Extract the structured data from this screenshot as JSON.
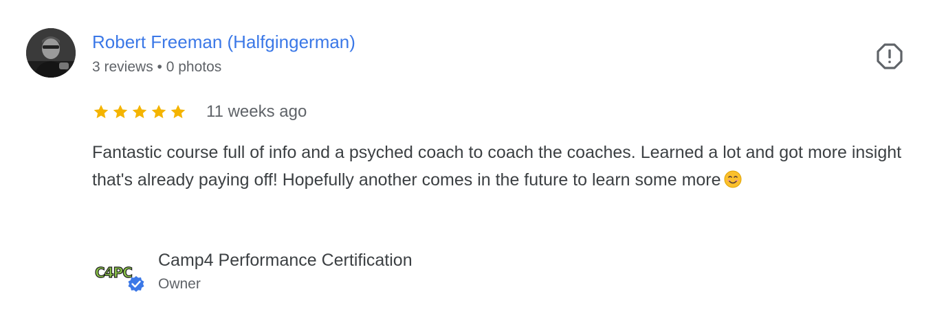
{
  "author": {
    "name": "Robert Freeman (Halfgingerman)",
    "meta": "3 reviews • 0 photos"
  },
  "review": {
    "rating": 5,
    "rating_max": 5,
    "date": "11 weeks ago",
    "text": "Fantastic course full of info and a psyched coach to coach the coaches. Learned a lot and got more insight that's already paying off! Hopefully another comes in the future to learn some more"
  },
  "owner": {
    "logo_text": "C4PC",
    "name": "Camp4 Performance Certification",
    "role": "Owner"
  },
  "icons": {
    "avatar": "profile-photo",
    "flag": "report-octagon-icon",
    "star": "star-icon",
    "emoji": "smiling-face-emoji",
    "verified": "verified-badge-icon"
  },
  "colors": {
    "author_link": "#3b78e7",
    "star": "#f4b400",
    "text": "#3c4043",
    "secondary_text": "#5f6368",
    "verified_badge": "#3b78e7",
    "logo_green": "#8bc34a"
  }
}
